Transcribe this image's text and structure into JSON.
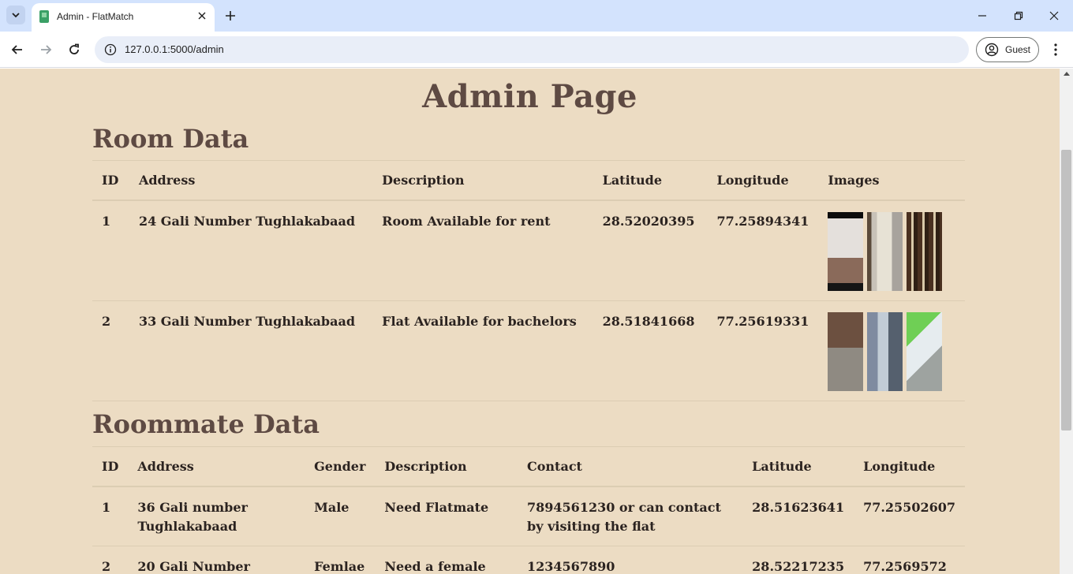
{
  "browser": {
    "tab_title": "Admin - FlatMatch",
    "url": "127.0.0.1:5000/admin",
    "profile_label": "Guest"
  },
  "page": {
    "title": "Admin Page"
  },
  "room_section": {
    "title": "Room Data",
    "columns": [
      "ID",
      "Address",
      "Description",
      "Latitude",
      "Longitude",
      "Images"
    ],
    "rows": [
      {
        "id": "1",
        "address": "24 Gali Number Tughlakabaad",
        "description": "Room Available for rent",
        "latitude": "28.52020395",
        "longitude": "77.25894341",
        "images": [
          "room-1-photo-1",
          "room-1-photo-2",
          "room-1-photo-3"
        ]
      },
      {
        "id": "2",
        "address": "33 Gali Number Tughlakabaad",
        "description": "Flat Available for bachelors",
        "latitude": "28.51841668",
        "longitude": "77.25619331",
        "images": [
          "room-2-photo-1",
          "room-2-photo-2",
          "room-2-photo-3"
        ]
      }
    ]
  },
  "roommate_section": {
    "title": "Roommate Data",
    "columns": [
      "ID",
      "Address",
      "Gender",
      "Description",
      "Contact",
      "Latitude",
      "Longitude"
    ],
    "rows": [
      {
        "id": "1",
        "address": "36 Gali number Tughlakabaad",
        "gender": "Male",
        "description": "Need Flatmate",
        "contact": "7894561230 or can contact by visiting the flat",
        "latitude": "28.51623641",
        "longitude": "77.25502607"
      },
      {
        "id": "2",
        "address": "20 Gali Number",
        "gender": "Femlae",
        "description": "Need a female",
        "contact": "1234567890",
        "latitude": "28.52217235",
        "longitude": "77.2569572"
      }
    ]
  }
}
